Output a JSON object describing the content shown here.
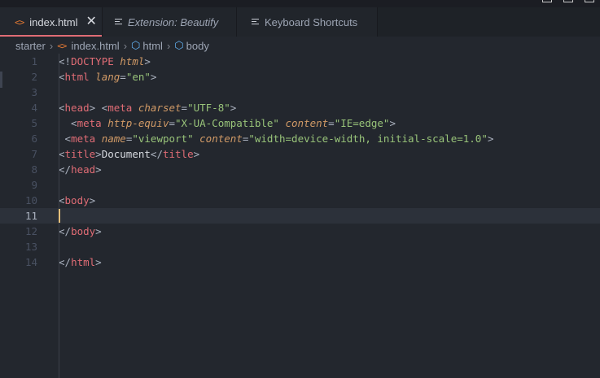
{
  "tabs": [
    {
      "label": "index.html",
      "icon": "html-file-icon",
      "active": true,
      "closable": true
    },
    {
      "label": "Extension: Beautify",
      "icon": "preview-icon",
      "active": false,
      "italic": true
    },
    {
      "label": "Keyboard Shortcuts",
      "icon": "preview-icon",
      "active": false
    }
  ],
  "breadcrumb": {
    "folder": "starter",
    "file": "index.html",
    "element1": "html",
    "element2": "body"
  },
  "editor": {
    "current_line": 11,
    "lines": [
      {
        "n": "1",
        "tokens": [
          [
            "p",
            "<!"
          ],
          [
            "t",
            "DOCTYPE"
          ],
          [
            "p",
            " "
          ],
          [
            "a",
            "html"
          ],
          [
            "p",
            ">"
          ]
        ]
      },
      {
        "n": "2",
        "tokens": [
          [
            "p",
            "<"
          ],
          [
            "t",
            "html"
          ],
          [
            "p",
            " "
          ],
          [
            "a",
            "lang"
          ],
          [
            "p",
            "="
          ],
          [
            "s",
            "\"en\""
          ],
          [
            "p",
            ">"
          ]
        ]
      },
      {
        "n": "3",
        "tokens": []
      },
      {
        "n": "4",
        "tokens": [
          [
            "p",
            "<"
          ],
          [
            "t",
            "head"
          ],
          [
            "p",
            "> <"
          ],
          [
            "t",
            "meta"
          ],
          [
            "p",
            " "
          ],
          [
            "a",
            "charset"
          ],
          [
            "p",
            "="
          ],
          [
            "s",
            "\"UTF-8\""
          ],
          [
            "p",
            ">"
          ]
        ]
      },
      {
        "n": "5",
        "tokens": [
          [
            "p",
            "  <"
          ],
          [
            "t",
            "meta"
          ],
          [
            "p",
            " "
          ],
          [
            "a",
            "http-equiv"
          ],
          [
            "p",
            "="
          ],
          [
            "s",
            "\"X-UA-Compatible\""
          ],
          [
            "p",
            " "
          ],
          [
            "a",
            "content"
          ],
          [
            "p",
            "="
          ],
          [
            "s",
            "\"IE=edge\""
          ],
          [
            "p",
            ">"
          ]
        ]
      },
      {
        "n": "6",
        "tokens": [
          [
            "p",
            " <"
          ],
          [
            "t",
            "meta"
          ],
          [
            "p",
            " "
          ],
          [
            "a",
            "name"
          ],
          [
            "p",
            "="
          ],
          [
            "s",
            "\"viewport\""
          ],
          [
            "p",
            " "
          ],
          [
            "a",
            "content"
          ],
          [
            "p",
            "="
          ],
          [
            "s",
            "\"width=device-width, initial-scale=1.0\""
          ],
          [
            "p",
            ">"
          ]
        ]
      },
      {
        "n": "7",
        "tokens": [
          [
            "p",
            "<"
          ],
          [
            "t",
            "title"
          ],
          [
            "p",
            ">"
          ],
          [
            "tx",
            "Document"
          ],
          [
            "p",
            "</"
          ],
          [
            "t",
            "title"
          ],
          [
            "p",
            ">"
          ]
        ]
      },
      {
        "n": "8",
        "tokens": [
          [
            "p",
            "</"
          ],
          [
            "t",
            "head"
          ],
          [
            "p",
            ">"
          ]
        ]
      },
      {
        "n": "9",
        "tokens": []
      },
      {
        "n": "10",
        "tokens": [
          [
            "p",
            "<"
          ],
          [
            "t",
            "body"
          ],
          [
            "p",
            ">"
          ]
        ]
      },
      {
        "n": "11",
        "tokens": []
      },
      {
        "n": "12",
        "tokens": [
          [
            "p",
            "</"
          ],
          [
            "t",
            "body"
          ],
          [
            "p",
            ">"
          ]
        ]
      },
      {
        "n": "13",
        "tokens": []
      },
      {
        "n": "14",
        "tokens": [
          [
            "p",
            "</"
          ],
          [
            "t",
            "html"
          ],
          [
            "p",
            ">"
          ]
        ]
      }
    ]
  },
  "colors": {
    "tag": "#e06c75",
    "attribute": "#d19a66",
    "string": "#98c379",
    "background": "#23272e",
    "cursor": "#e5c07b"
  }
}
